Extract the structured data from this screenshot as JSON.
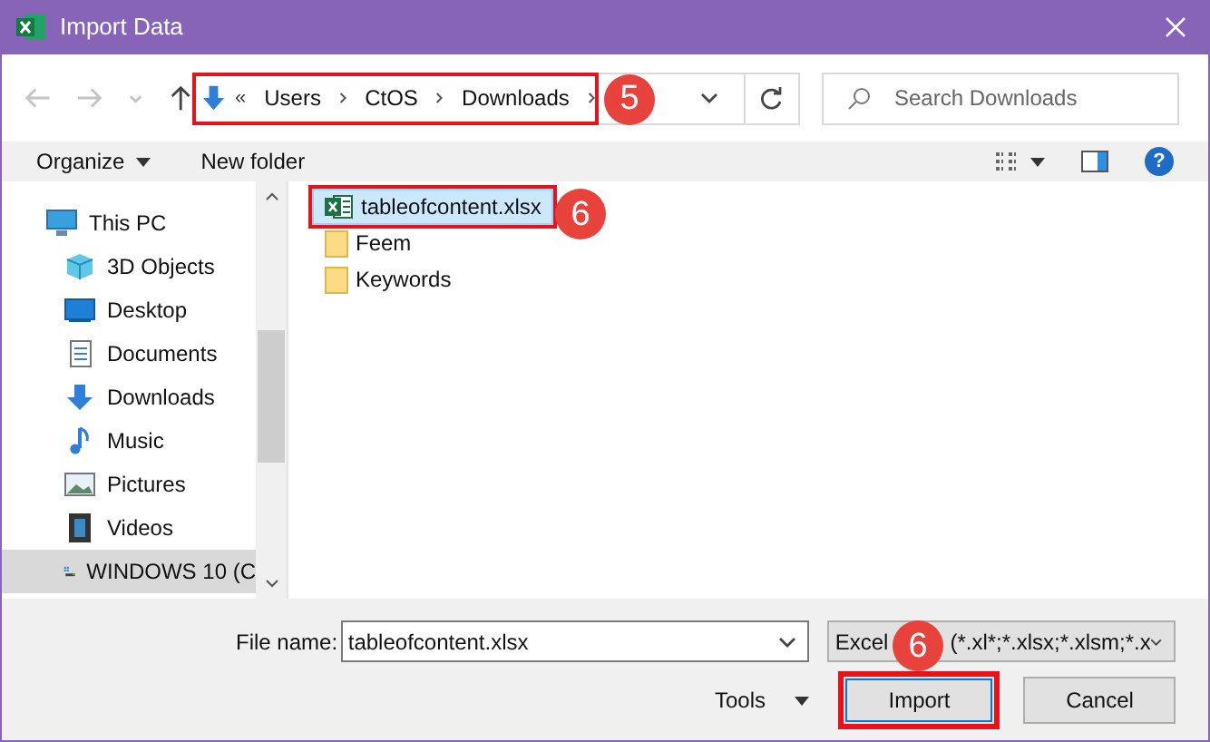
{
  "window": {
    "title": "Import Data"
  },
  "nav_buttons": [
    {
      "kind": "back",
      "disabled": true
    },
    {
      "kind": "forward",
      "disabled": true
    },
    {
      "kind": "recent",
      "disabled": true
    },
    {
      "kind": "up",
      "disabled": false
    }
  ],
  "breadcrumb": {
    "overflow": "«",
    "parts": [
      "Users",
      "CtOS",
      "Downloads"
    ]
  },
  "search": {
    "placeholder": "Search Downloads"
  },
  "toolbar": {
    "organize": "Organize",
    "new_folder": "New folder",
    "help": "?"
  },
  "sidebar": {
    "items": [
      {
        "label": "This PC",
        "kind": "pc",
        "selected": false,
        "children": [
          {
            "label": "3D Objects",
            "kind": "cube",
            "selected": false
          },
          {
            "label": "Desktop",
            "kind": "desktop",
            "selected": false
          },
          {
            "label": "Documents",
            "kind": "document",
            "selected": false
          },
          {
            "label": "Downloads",
            "kind": "download",
            "selected": false
          },
          {
            "label": "Music",
            "kind": "music",
            "selected": false
          },
          {
            "label": "Pictures",
            "kind": "picture",
            "selected": false
          },
          {
            "label": "Videos",
            "kind": "video",
            "selected": false
          },
          {
            "label": "WINDOWS 10 (C",
            "kind": "drive",
            "selected": true
          }
        ]
      }
    ]
  },
  "files": [
    {
      "name": "tableofcontent.xlsx",
      "kind": "excel",
      "selected": true
    },
    {
      "name": "Feem",
      "kind": "folder",
      "selected": false
    },
    {
      "name": "Keywords",
      "kind": "folder",
      "selected": false
    }
  ],
  "file_name": {
    "label": "File name:",
    "value": "tableofcontent.xlsx"
  },
  "file_type": {
    "visible_start": "Excel",
    "visible_end": "(*.xl*;*.xlsx;*.xlsm;*.x"
  },
  "tools": "Tools",
  "buttons": {
    "primary": "Import",
    "secondary": "Cancel"
  },
  "annotations": [
    "5",
    "6",
    "6"
  ]
}
